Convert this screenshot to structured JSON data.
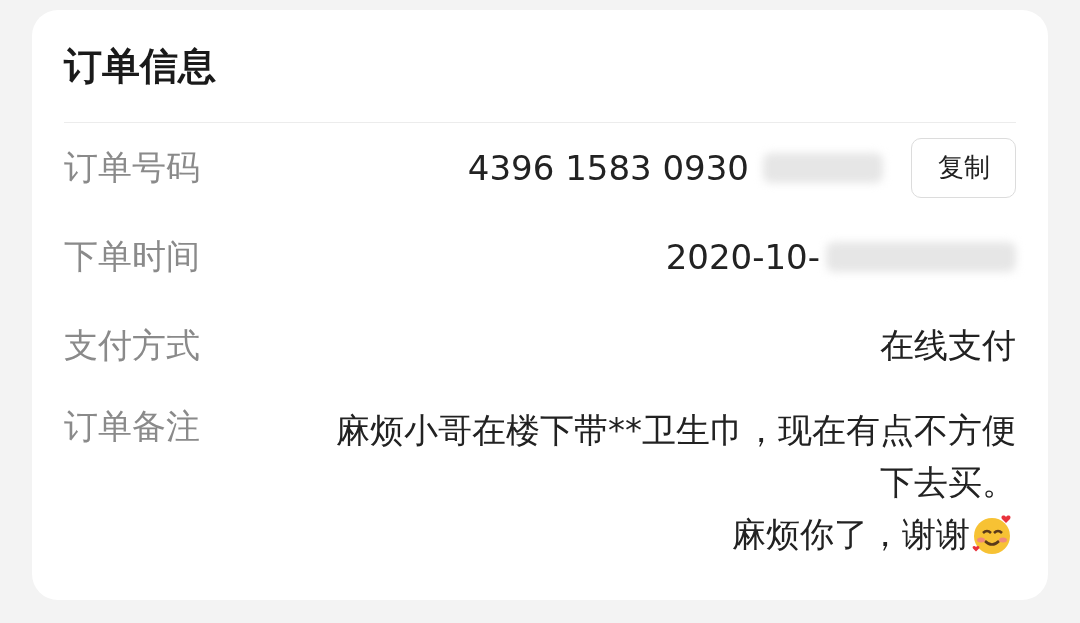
{
  "card": {
    "title": "订单信息",
    "rows": [
      {
        "kind": "copy",
        "label": "订单号码",
        "value": "4396 1583 0930",
        "redacted": true,
        "button": "复制"
      },
      {
        "kind": "text",
        "label": "下单时间",
        "value": "2020-10-",
        "redacted": true
      },
      {
        "kind": "text",
        "label": "支付方式",
        "value": "在线支付"
      },
      {
        "kind": "note",
        "label": "订单备注",
        "lines": [
          "麻烦小哥在楼下带**卫生巾，现在有点不方便下去买。",
          "麻烦你了，谢谢"
        ]
      }
    ]
  }
}
